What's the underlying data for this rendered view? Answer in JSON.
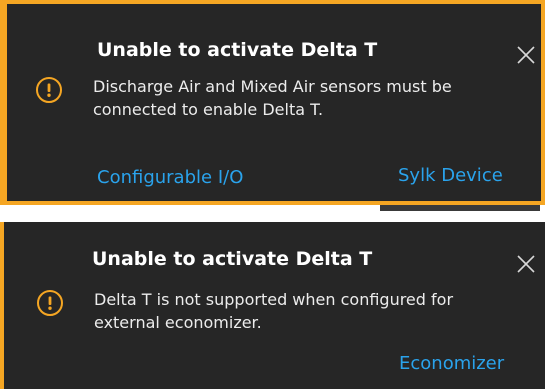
{
  "accent_color": "#f5a623",
  "link_color": "#2aa3ec",
  "toasts": [
    {
      "title": "Unable to activate Delta T",
      "message_line1": "Discharge Air and Mixed Air sensors must be",
      "message_line2": "connected to enable Delta T.",
      "actions": [
        "Configurable I/O",
        "Sylk Device"
      ],
      "icon": "warning-icon",
      "close_icon": "close-icon"
    },
    {
      "title": "Unable to activate Delta T",
      "message_line1": "Delta T is not supported when configured for",
      "message_line2": "external economizer.",
      "actions": [
        "Economizer"
      ],
      "icon": "warning-icon",
      "close_icon": "close-icon"
    }
  ]
}
